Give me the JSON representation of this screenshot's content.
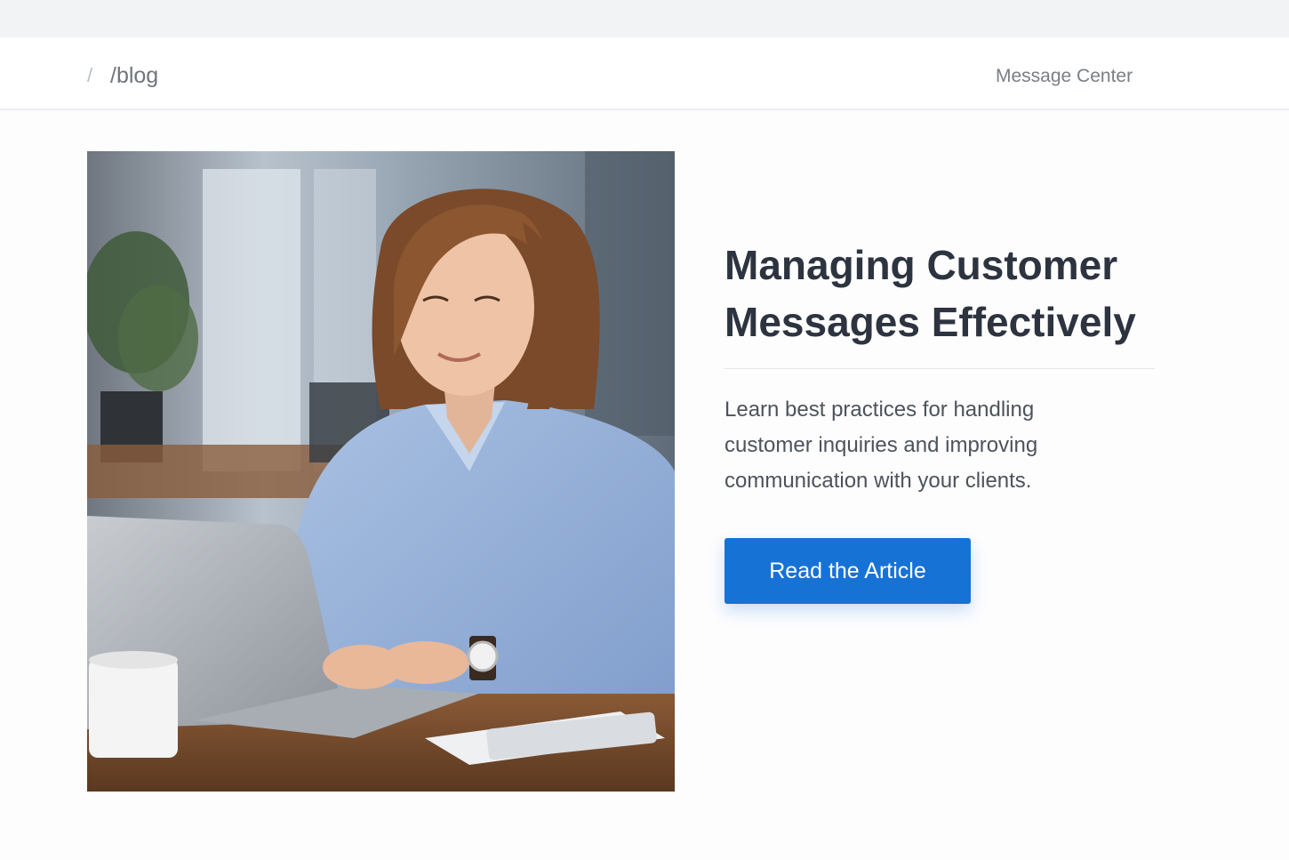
{
  "breadcrumb": {
    "separator": "/",
    "current": "/blog"
  },
  "header": {
    "nav_link": "Message Center"
  },
  "article": {
    "title_lines": [
      "Managing Customer",
      "Messages Effectively"
    ],
    "description_lines": [
      "Learn best practices for handling",
      "customer inquiries and improving",
      "communication with your clients."
    ],
    "cta_label": "Read the Article"
  },
  "colors": {
    "accent": "#1772d6",
    "title": "#2d3440",
    "body_text": "#4d535c",
    "muted_text": "#7a7f86"
  }
}
